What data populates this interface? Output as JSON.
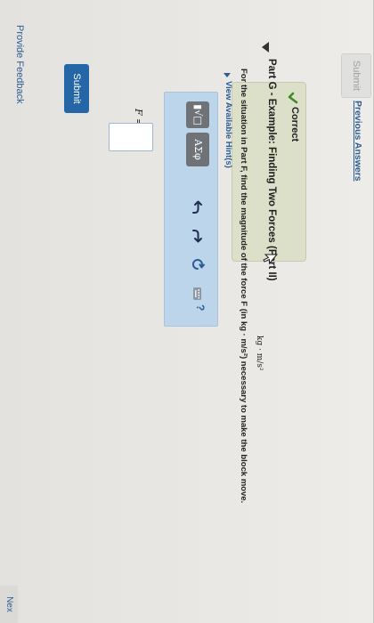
{
  "header": {
    "submit_label": "Submit",
    "previous_answers_label": "Previous Answers"
  },
  "feedback": {
    "status_label": "Correct"
  },
  "sidebar": {
    "provide_feedback_label": "Provide Feedback"
  },
  "part": {
    "title": "Part G - Example: Finding Two Forces (Part II)",
    "instructions": "For the situation in Part F, find the magnitude of the force F (in kg · m/s²) necessary to make the block move.",
    "hints_label": "View Available Hint(s)"
  },
  "toolbar": {
    "templates_label": "▮√□",
    "greek_label": "ΑΣφ",
    "undo_icon": "undo-icon",
    "redo_icon": "redo-icon",
    "reset_icon": "reset-icon",
    "keyboard_icon": "keyboard-icon",
    "help_label": "?"
  },
  "answer": {
    "variable_label": "F =",
    "value": "",
    "unit_label": "kg · m/s²"
  },
  "actions": {
    "submit_label": "Submit",
    "next_label": "Nex"
  },
  "colors": {
    "link": "#2b5c93",
    "primary_button": "#2466a6",
    "toolbar_bg": "#bcd5ea",
    "correct_bg": "#dde0c9",
    "check": "#3d8a2a"
  }
}
